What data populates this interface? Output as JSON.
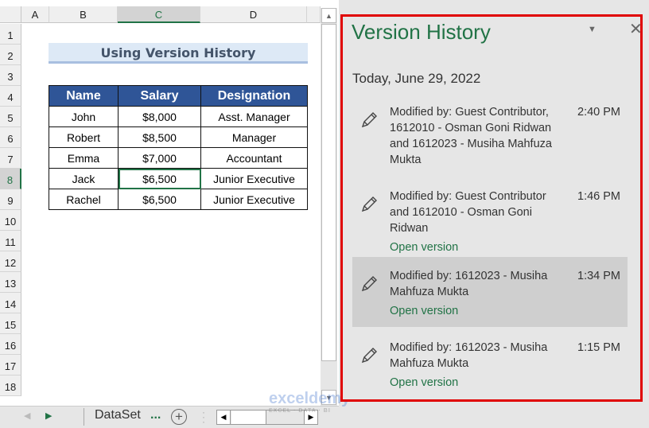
{
  "sheet": {
    "columns": [
      "A",
      "B",
      "C",
      "D"
    ],
    "rows": [
      "1",
      "2",
      "3",
      "4",
      "5",
      "6",
      "7",
      "8",
      "9",
      "10",
      "11",
      "12",
      "13",
      "14",
      "15",
      "16",
      "17",
      "18"
    ],
    "title": "Using Version History",
    "headers": [
      "Name",
      "Salary",
      "Designation"
    ],
    "data": [
      [
        "John",
        "$8,000",
        "Asst. Manager"
      ],
      [
        "Robert",
        "$8,500",
        "Manager"
      ],
      [
        "Emma",
        "$7,000",
        "Accountant"
      ],
      [
        "Jack",
        "$6,500",
        "Junior Executive"
      ],
      [
        "Rachel",
        "$6,500",
        "Junior Executive"
      ]
    ],
    "tab": "DataSet",
    "tab_more": "...",
    "watermark": "exceldemy",
    "watermark_sub": "EXCEL · DATA · BI"
  },
  "panel": {
    "title": "Version History",
    "date": "Today, June 29, 2022",
    "entries": [
      {
        "text": "Modified by: Guest Contributor, 1612010 - Osman Goni Ridwan and 1612023 - Musiha Mahfuza Mukta",
        "time": "2:40 PM",
        "open": ""
      },
      {
        "text": "Modified by: Guest Contributor and 1612010 - Osman Goni Ridwan",
        "time": "1:46 PM",
        "open": "Open version"
      },
      {
        "text": "Modified by: 1612023 - Musiha Mahfuza Mukta",
        "time": "1:34 PM",
        "open": "Open version"
      },
      {
        "text": "Modified by: 1612023 - Musiha Mahfuza Mukta",
        "time": "1:15 PM",
        "open": "Open version"
      }
    ]
  },
  "colors": {
    "accent": "#217346",
    "header": "#2f5597",
    "highlight": "#e00000"
  }
}
